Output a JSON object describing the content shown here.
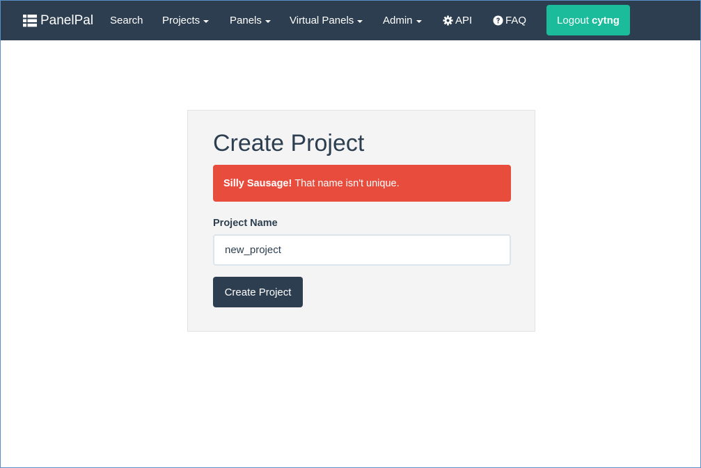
{
  "navbar": {
    "brand": "PanelPal",
    "items": [
      {
        "label": "Search",
        "dropdown": false
      },
      {
        "label": "Projects",
        "dropdown": true
      },
      {
        "label": "Panels",
        "dropdown": true
      },
      {
        "label": "Virtual Panels",
        "dropdown": true
      },
      {
        "label": "Admin",
        "dropdown": true
      },
      {
        "label": "API",
        "icon": "gear-icon"
      },
      {
        "label": "FAQ",
        "icon": "question-circle-icon"
      }
    ],
    "logout": {
      "prefix": "Logout",
      "username": "cytng"
    }
  },
  "form": {
    "title": "Create Project",
    "alert": {
      "strong": "Silly Sausage!",
      "message": "That name isn't unique."
    },
    "project_name_label": "Project Name",
    "project_name_value": "new_project",
    "submit_label": "Create Project"
  },
  "colors": {
    "navbar": "#2c3e50",
    "logout": "#1abc9c",
    "alert": "#e74c3c",
    "well": "#f4f4f4",
    "button": "#2c3e50"
  }
}
